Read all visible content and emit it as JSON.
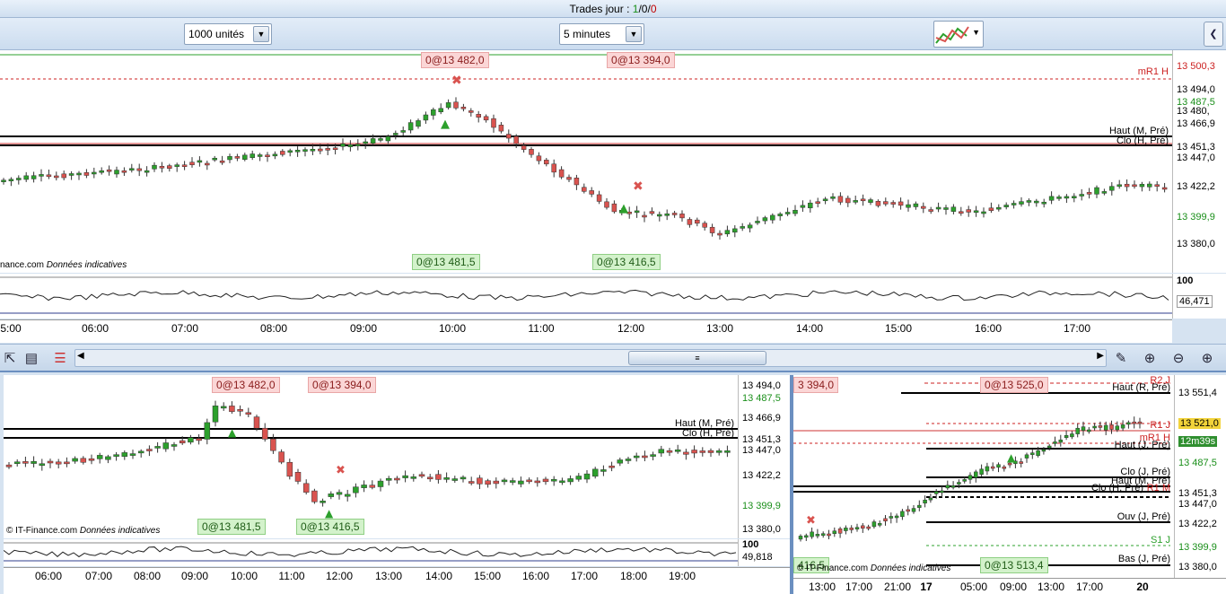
{
  "topbar": {
    "label": "Trades jour :",
    "v1": "1",
    "sep1": "/",
    "v2": "0",
    "sep2": "/",
    "v3": "0"
  },
  "toolbar": {
    "units": "1000 unités",
    "interval": "5 minutes"
  },
  "main": {
    "tags": {
      "t1": "0@13 482,0",
      "t2": "0@13 394,0",
      "b1": "0@13 481,5",
      "b2": "0@13 416,5"
    },
    "credit": {
      "site": "nance.com",
      "note": "Données indicatives"
    },
    "levels": {
      "mr1": "mR1 H",
      "haut": "Haut (M, Pré)",
      "clo": "Clo (H, Pré)"
    },
    "axis": [
      "13 500,3",
      "13 494,0",
      "13 487,5",
      "13 480,",
      "13 466,9",
      "13 451,3",
      "13 447,0",
      "13 422,2",
      "13 399,9",
      "13 380,0"
    ],
    "osc": {
      "top": "100",
      "val": "46,471"
    },
    "xlabels": [
      "5:00",
      "06:00",
      "07:00",
      "08:00",
      "09:00",
      "10:00",
      "11:00",
      "12:00",
      "13:00",
      "14:00",
      "15:00",
      "16:00",
      "17:00"
    ]
  },
  "left": {
    "tags": {
      "t1": "0@13 482,0",
      "t2": "0@13 394,0",
      "b1": "0@13 481,5",
      "b2": "0@13 416,5"
    },
    "credit": {
      "site": "© IT-Finance.com",
      "note": "Données indicatives"
    },
    "levels": {
      "haut": "Haut (M, Pré)",
      "clo": "Clo (H, Pré)"
    },
    "axis": [
      "13 494,0",
      "13 487,5",
      "13 466,9",
      "13 451,3",
      "13 447,0",
      "13 422,2",
      "13 399,9",
      "13 380,0"
    ],
    "osc": {
      "top": "100",
      "val": "49,818"
    },
    "xlabels": [
      "06:00",
      "07:00",
      "08:00",
      "09:00",
      "10:00",
      "11:00",
      "12:00",
      "13:00",
      "14:00",
      "15:00",
      "16:00",
      "17:00",
      "18:00",
      "19:00"
    ]
  },
  "right": {
    "tags": {
      "t1": "3 394,0",
      "t2": "0@13 525,0",
      "b1": "416,5",
      "b2": "0@13 513,4"
    },
    "credit": {
      "site": "© IT-Finance.com",
      "note": "Données indicatives"
    },
    "levels": {
      "r2": "R2 J",
      "hautR": "Haut (R, Pré)",
      "r1": "R1 J",
      "mr1": "mR1 H",
      "hautJ": "Haut (J, Pré)",
      "cloJ": "Clo (J, Pré)",
      "hautM": "Haut (M, Pré)",
      "cloH": "Clo (H, Pré)",
      "rm": "R1 M",
      "ouvJ": "Ouv (J, Pré)",
      "s1J": "S1 J",
      "basJ": "Bas (J, Pré)"
    },
    "axis": [
      "13 551,4",
      "13 521,0",
      "12m39s",
      "13 487,5",
      "13 451,3",
      "13 447,0",
      "13 422,2",
      "13 399,9",
      "13 380,0"
    ],
    "xlabels": [
      "13:00",
      "17:00",
      "21:00",
      "17",
      "05:00",
      "09:00",
      "13:00",
      "17:00",
      "20"
    ]
  },
  "colors": {
    "up": "#2ca02c",
    "down": "#d9534f",
    "level": "#000000",
    "dash": "#cc2222"
  }
}
